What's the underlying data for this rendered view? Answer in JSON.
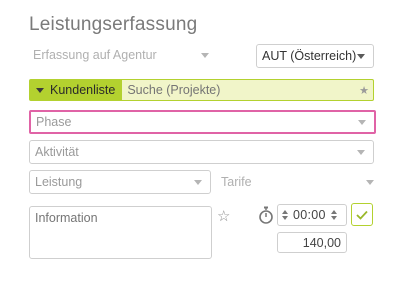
{
  "page": {
    "title": "Leistungserfassung"
  },
  "form": {
    "erfassung": {
      "label": "Erfassung auf Agentur"
    },
    "country": {
      "value": "AUT (Österreich)"
    },
    "search": {
      "list_label": "Kundenliste",
      "placeholder": "Suche (Projekte)"
    },
    "phase": {
      "placeholder": "Phase"
    },
    "aktivitaet": {
      "placeholder": "Aktivität"
    },
    "leistung": {
      "placeholder": "Leistung"
    },
    "tarife": {
      "label": "Tarife"
    },
    "information": {
      "placeholder": "Information"
    },
    "time": {
      "value": "00:00"
    },
    "amount": {
      "value": "140,00"
    }
  },
  "colors": {
    "accent": "#b3d12f",
    "accent_light": "#f1f5c9",
    "focus": "#e063a6"
  },
  "icons": [
    "chevron-down-icon",
    "star-icon",
    "stopwatch-icon",
    "check-icon"
  ]
}
